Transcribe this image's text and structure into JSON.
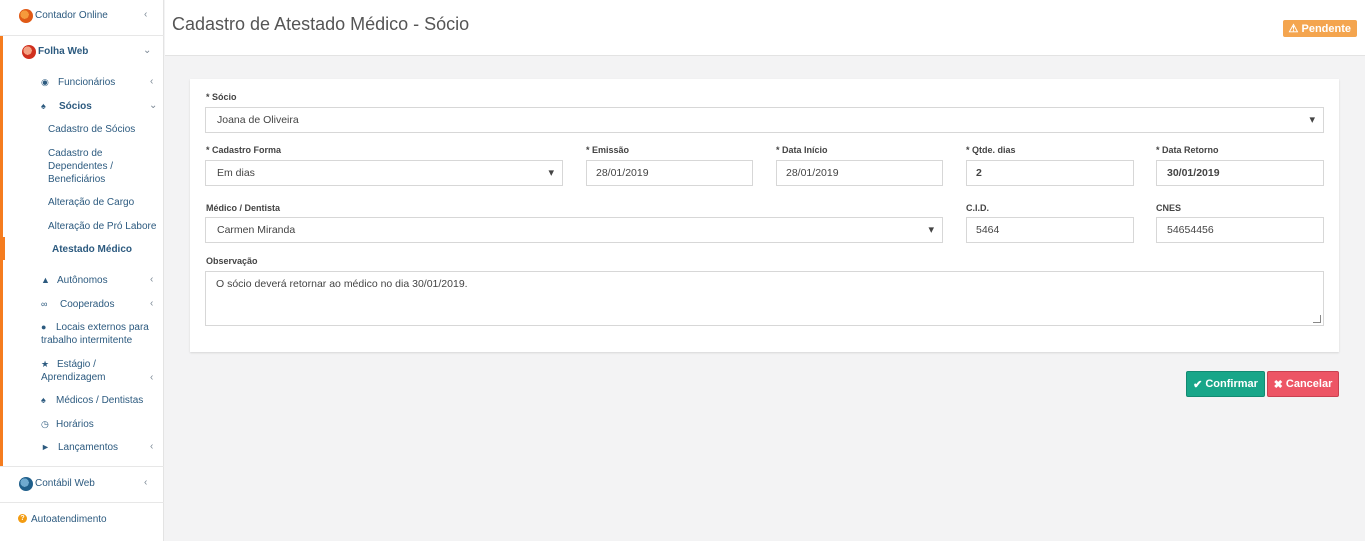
{
  "sidebar": {
    "contador_online": "Contador Online",
    "folha_web": "Folha Web",
    "funcionarios": "Funcionários",
    "socios": "Sócios",
    "submenu": {
      "cadastro_socios": "Cadastro de Sócios",
      "cadastro_dependentes_1": "Cadastro de",
      "cadastro_dependentes_2": "Dependentes /",
      "cadastro_dependentes_3": "Beneficiários",
      "alteracao_cargo": "Alteração de Cargo",
      "alteracao_pro_labore": "Alteração de Pró Labore",
      "atestado_medico": "Atestado Médico"
    },
    "autonomos": "Autônomos",
    "cooperados": "Cooperados",
    "locais_1": "Locais externos para",
    "locais_2": "trabalho intermitente",
    "estagio_1": "Estágio /",
    "estagio_2": "Aprendizagem",
    "medicos": "Médicos / Dentistas",
    "horarios": "Horários",
    "lancamentos": "Lançamentos",
    "contabil_web": "Contábil Web",
    "autoatendimento": "Autoatendimento"
  },
  "header": {
    "title": "Cadastro de Atestado Médico - Sócio",
    "status": "Pendente"
  },
  "form": {
    "socio_label": "* Sócio",
    "socio_value": "Joana de Oliveira",
    "cadastro_forma_label": "* Cadastro Forma",
    "cadastro_forma_value": "Em dias",
    "emissao_label": "* Emissão",
    "emissao_value": "28/01/2019",
    "data_inicio_label": "* Data Início",
    "data_inicio_value": "28/01/2019",
    "qtde_dias_label": "* Qtde. dias",
    "qtde_dias_value": "2",
    "data_retorno_label": "* Data Retorno",
    "data_retorno_value": "30/01/2019",
    "medico_label": "Médico / Dentista",
    "medico_value": "Carmen Miranda",
    "cid_label": "C.I.D.",
    "cid_value": "5464",
    "cnes_label": "CNES",
    "cnes_value": "54654456",
    "observacao_label": "Observação",
    "observacao_value": "O sócio deverá retornar ao médico no dia 30/01/2019."
  },
  "buttons": {
    "confirm": "Confirmar",
    "cancel": "Cancelar"
  },
  "colors": {
    "accent_orange": "#f57c1f",
    "confirm_green": "#18a689",
    "cancel_red": "#ed5565",
    "badge_orange": "#f4a54f"
  }
}
